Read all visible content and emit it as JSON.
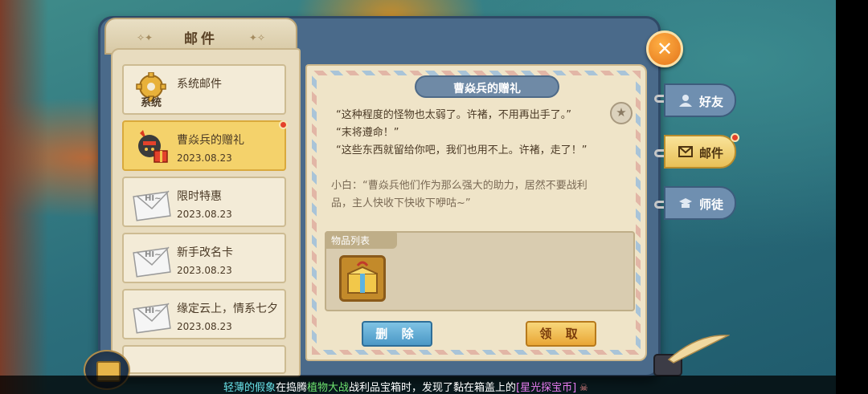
{
  "left_panel": {
    "title": "邮件",
    "mails": [
      {
        "name": "系统邮件",
        "date": "",
        "icon": "gear-system-icon",
        "icon_caption": "系统",
        "unread": false,
        "active": false
      },
      {
        "name": "曹焱兵的赠礼",
        "date": "2023.08.23",
        "icon": "warrior-gift-icon",
        "unread": true,
        "active": true
      },
      {
        "name": "限时特惠",
        "date": "2023.08.23",
        "icon": "hi-envelope-icon",
        "icon_caption": "HI~",
        "unread": false,
        "active": false
      },
      {
        "name": "新手改名卡",
        "date": "2023.08.23",
        "icon": "hi-envelope-icon",
        "icon_caption": "HI~",
        "unread": false,
        "active": false
      },
      {
        "name": "缘定云上，情系七夕",
        "date": "2023.08.23",
        "icon": "hi-envelope-icon",
        "icon_caption": "HI~",
        "unread": false,
        "active": false
      }
    ]
  },
  "letter": {
    "title": "曹焱兵的赠礼",
    "lines": [
      "“这种程度的怪物也太弱了。许褚，不用再出手了。”",
      "“末将遵命！”",
      "“这些东西就留给你吧，我们也用不上。许褚，走了！”"
    ],
    "note_line1": "小白：“曹焱兵他们作为那么强大的助力，居然不要战利",
    "note_line2": "品，主人快收下快收下咿咕~”",
    "items_label": "物品列表",
    "delete_label": "删 除",
    "claim_label": "领 取"
  },
  "side_tabs": [
    {
      "label": "好友",
      "icon": "friend-icon",
      "active": false
    },
    {
      "label": "邮件",
      "icon": "mail-icon",
      "active": true
    },
    {
      "label": "师徒",
      "icon": "mentor-icon",
      "active": false
    }
  ],
  "ticker": {
    "part1": "轻薄的假象",
    "part2": "在捣腾",
    "part3": "植物大战",
    "part4": "战利品宝箱时，发现了黏在箱盖上的",
    "part5": "[星光探宝币]"
  },
  "colors": {
    "accent_gold": "#f4d26b",
    "tab_blue": "#6f8fb0",
    "delete_blue": "#4b98c6",
    "claim_orange": "#e9a635",
    "unread_red": "#e4422b"
  }
}
